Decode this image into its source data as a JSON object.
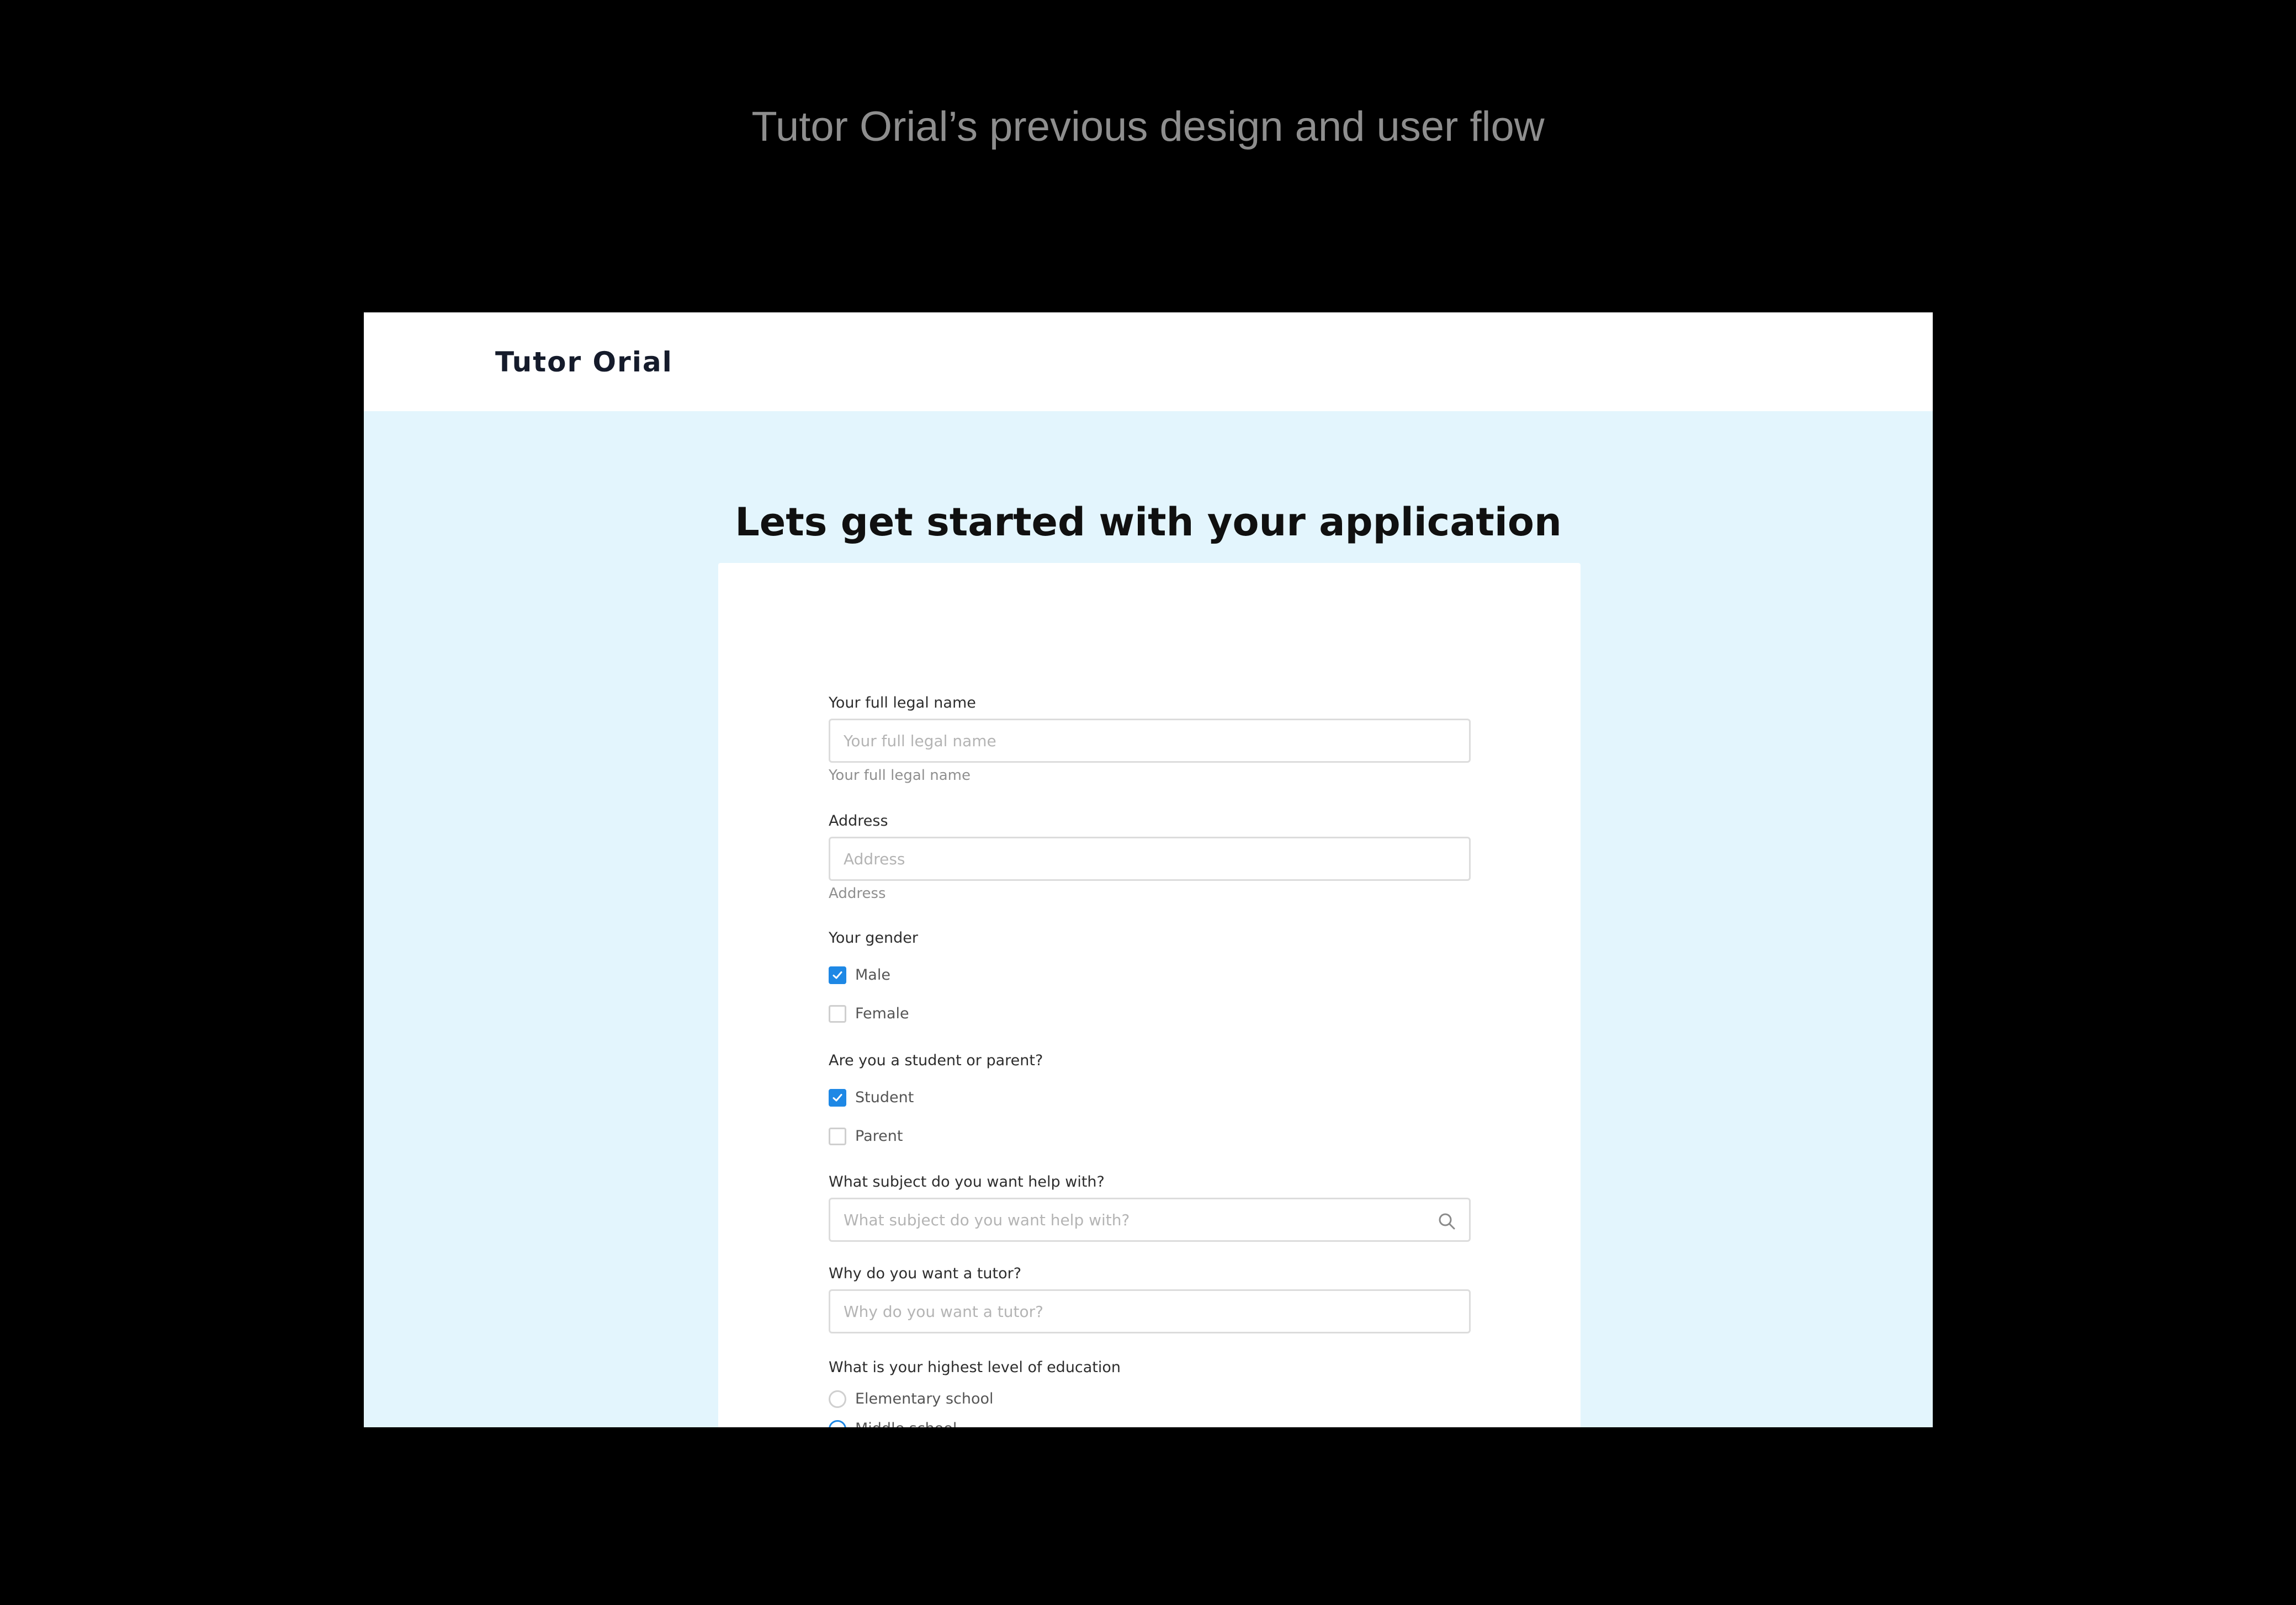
{
  "caption": "Tutor Orial’s previous design and user flow",
  "app": {
    "brand": "Tutor Orial",
    "headline": "Lets get started with your application"
  },
  "form": {
    "full_name": {
      "label": "Your full legal name",
      "placeholder": "Your full legal name",
      "helper": "Your full legal name"
    },
    "address": {
      "label": "Address",
      "placeholder": "Address",
      "helper": "Address"
    },
    "gender": {
      "label": "Your gender",
      "options": [
        {
          "label": "Male",
          "checked": true
        },
        {
          "label": "Female",
          "checked": false
        }
      ]
    },
    "role": {
      "label": "Are you a student or parent?",
      "options": [
        {
          "label": "Student",
          "checked": true
        },
        {
          "label": "Parent",
          "checked": false
        }
      ]
    },
    "subject": {
      "label": "What subject do you want help with?",
      "placeholder": "What subject do you want help with?",
      "icon": "search-icon"
    },
    "reason": {
      "label": "Why do you want a tutor?",
      "placeholder": "Why do you want a tutor?"
    },
    "education": {
      "label": "What is your highest level of education",
      "options": [
        {
          "label": "Elementary school",
          "selected": false
        },
        {
          "label": "Middle school",
          "selected": true
        }
      ]
    }
  },
  "colors": {
    "page_background": "#000000",
    "frame_background": "#e3f5fd",
    "accent": "#1e88e5",
    "brand_text": "#151b2b"
  }
}
